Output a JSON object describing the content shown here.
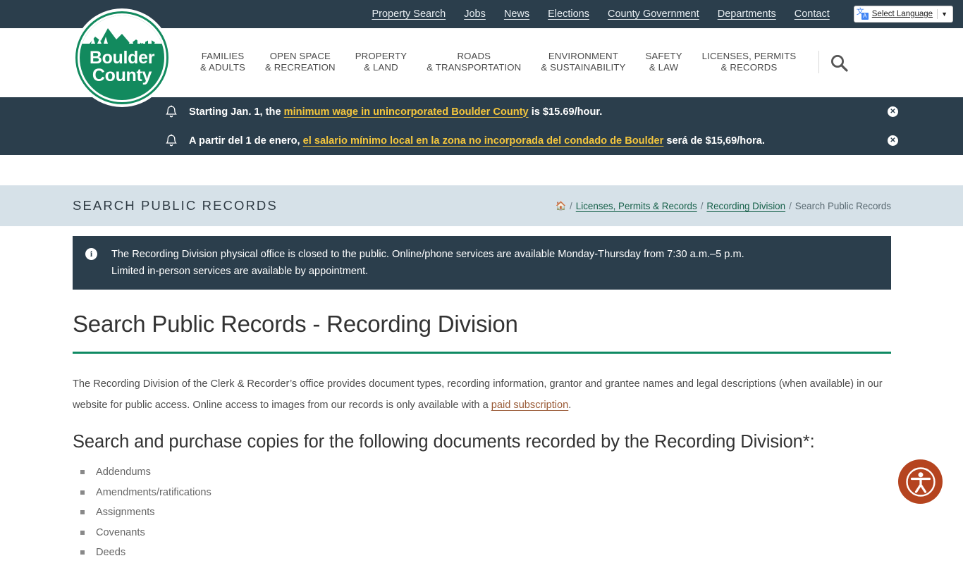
{
  "topbar": {
    "links": [
      {
        "label": "Property Search"
      },
      {
        "label": "Jobs"
      },
      {
        "label": "News"
      },
      {
        "label": "Elections"
      },
      {
        "label": "County Government"
      },
      {
        "label": "Departments"
      },
      {
        "label": "Contact"
      }
    ],
    "translate": {
      "icon": "google-translate-icon",
      "label": "Select Language",
      "caret": "▼",
      "glyph_primary": "文",
      "glyph_secondary": "A"
    }
  },
  "logo": {
    "line1": "Boulder",
    "line2": "County",
    "color": "#128a5e"
  },
  "mainnav": {
    "items": [
      {
        "line1": "FAMILIES",
        "line2": "& ADULTS"
      },
      {
        "line1": "OPEN SPACE",
        "line2": "& RECREATION"
      },
      {
        "line1": "PROPERTY",
        "line2": "& LAND"
      },
      {
        "line1": "ROADS",
        "line2": "& TRANSPORTATION"
      },
      {
        "line1": "ENVIRONMENT",
        "line2": "& SUSTAINABILITY"
      },
      {
        "line1": "SAFETY",
        "line2": "& LAW"
      },
      {
        "line1": "LICENSES, PERMITS",
        "line2": "& RECORDS"
      }
    ],
    "search_icon": "search-icon"
  },
  "alerts": {
    "background": "#2b3e4c",
    "link_color": "#f4c63d",
    "close_label": "✕",
    "items": [
      {
        "icon": "bell-icon",
        "prefix": "Starting Jan. 1, the ",
        "link": "minimum wage in unincorporated Boulder County",
        "suffix": " is $15.69/hour."
      },
      {
        "icon": "bell-icon",
        "prefix": "A partir del 1 de enero, ",
        "link": "el salario mínimo local en la zona no incorporada del condado de Boulder",
        "suffix": " será de $15,69/hora."
      }
    ]
  },
  "titlebar": {
    "kicker": "SEARCH PUBLIC RECORDS",
    "background": "#d6e1e8",
    "breadcrumb": {
      "home_icon": "home-icon",
      "sep": "/",
      "link1": "Licenses, Permits & Records",
      "link2": "Recording Division",
      "current": "Search Public Records",
      "link_color": "#17614a"
    }
  },
  "content": {
    "info_box": {
      "icon": "info-icon",
      "text": "The Recording Division physical office is closed to the public. Online/phone services are available Monday-Thursday from 7:30 a.m.–5 p.m. Limited in-person services are available by appointment."
    },
    "heading": "Search Public Records - Recording Division",
    "heading_rule_color": "#0f8a63",
    "paragraph": {
      "before": "The Recording Division of the Clerk & Recorder’s office provides document types, recording information, grantor and grantee names and legal descriptions (when available) in our website for public access. Online access to images from our records is only available with a ",
      "link": "paid subscription",
      "after": "."
    },
    "subheading": "Search and purchase copies for the following documents recorded by the Recording Division*:",
    "documents": [
      "Addendums",
      "Amendments/ratifications",
      "Assignments",
      "Covenants",
      "Deeds"
    ]
  },
  "accessibility_fab": {
    "icon": "accessibility-icon",
    "color": "#b5441f"
  }
}
